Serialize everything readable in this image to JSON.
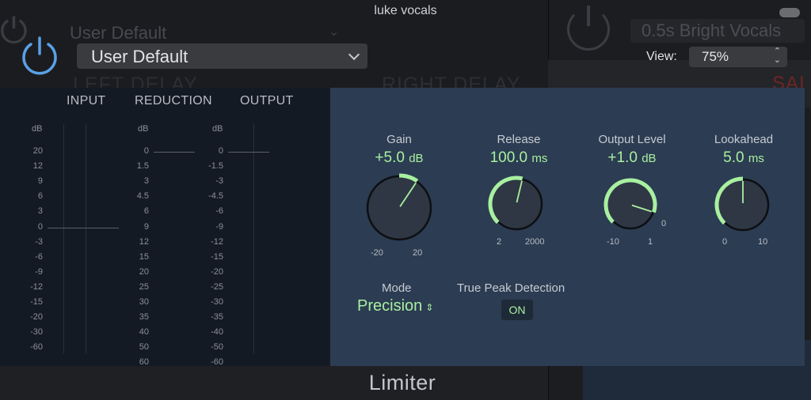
{
  "window": {
    "title": "luke vocals"
  },
  "background": {
    "left_preset": "User Default",
    "left_label": "LEFT DELAY",
    "right_label": "RIGHT DELAY",
    "right_preset": "0.5s Bright Vocals",
    "right_partial": "SAI"
  },
  "header": {
    "preset": "User Default",
    "view_label": "View:",
    "view_value": "75%"
  },
  "meters": {
    "headings": [
      "INPUT",
      "REDUCTION",
      "OUTPUT"
    ],
    "unit": "dB",
    "input_ticks": [
      "20",
      "12",
      "9",
      "6",
      "3",
      "0",
      "-3",
      "-6",
      "-9",
      "-12",
      "-15",
      "-20",
      "-30",
      "-60"
    ],
    "reduction_ticks": [
      "0",
      "1.5",
      "3",
      "4.5",
      "6",
      "9",
      "12",
      "15",
      "20",
      "25",
      "30",
      "35",
      "40",
      "50",
      "60"
    ],
    "output_ticks": [
      "0",
      "-1.5",
      "-3",
      "-4.5",
      "-6",
      "-9",
      "-12",
      "-15",
      "-20",
      "-25",
      "-30",
      "-35",
      "-40",
      "-50",
      "-60"
    ]
  },
  "controls": {
    "gain": {
      "title": "Gain",
      "value": "+5.0",
      "unit": "dB",
      "min": "-20",
      "max": "20",
      "fraction": 0.625
    },
    "release": {
      "title": "Release",
      "value": "100.0",
      "unit": "ms",
      "min": "2",
      "max": "2000",
      "fraction": 0.55
    },
    "output_level": {
      "title": "Output Level",
      "value": "+1.0",
      "unit": "dB",
      "min": "-10",
      "max": "1",
      "mid": "0",
      "fraction": 0.9
    },
    "lookahead": {
      "title": "Lookahead",
      "value": "5.0",
      "unit": "ms",
      "min": "0",
      "max": "10",
      "fraction": 0.5
    },
    "mode": {
      "title": "Mode",
      "value": "Precision"
    },
    "true_peak": {
      "title": "True Peak Detection",
      "value": "ON"
    }
  },
  "footer": {
    "plugin_name": "Limiter"
  },
  "colors": {
    "accent_green": "#a8f0a0",
    "power_blue": "#5aa0e6",
    "panel": "#2c3c52"
  },
  "icons": {
    "power": "power-icon",
    "chevron": "chevron-down-icon",
    "stepper": "up-down-arrows-icon"
  }
}
